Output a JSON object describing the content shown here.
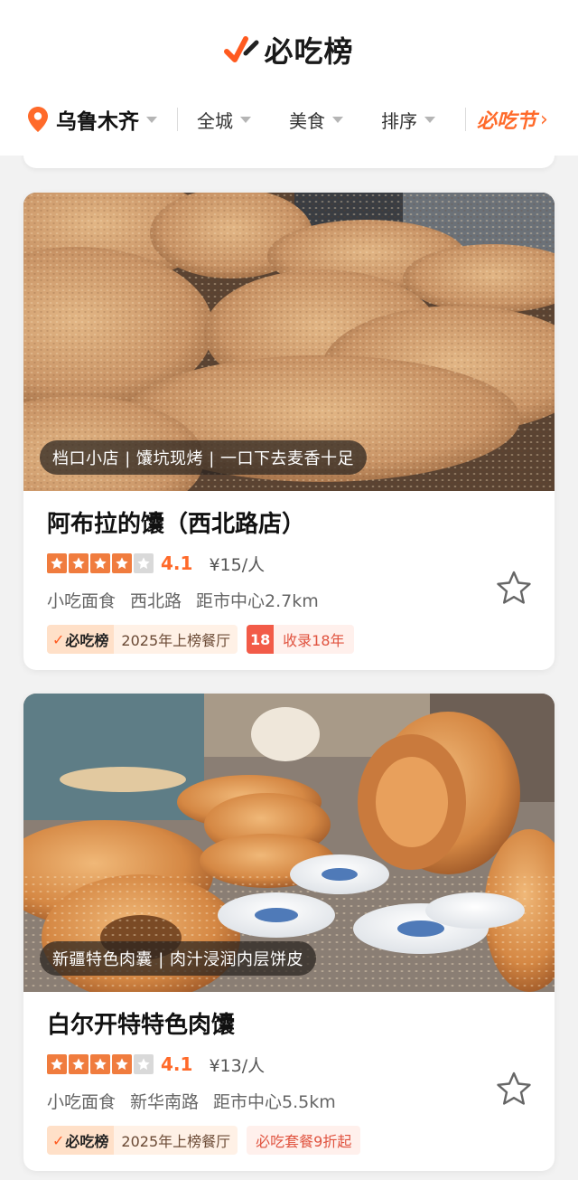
{
  "header": {
    "app_title": "必吃榜",
    "city": "乌鲁木齐",
    "filters": [
      "全城",
      "美食",
      "排序"
    ],
    "festival": "必吃节"
  },
  "colors": {
    "accent": "#ff6a2a",
    "star": "#f07c3e",
    "badge_red": "#f25b48"
  },
  "restaurants": [
    {
      "photo_tag": "档口小店 | 馕坑现烤 | 一口下去麦香十足",
      "name": "阿布拉的馕（西北路店）",
      "rating": 4.1,
      "rating_text": "4.1",
      "price": "¥15/人",
      "category": "小吃面食",
      "area": "西北路",
      "distance": "距市中心2.7km",
      "badge_logo": "必吃榜",
      "badge_text": "2025年上榜餐厅",
      "years_num": "18",
      "years_text": "收录18年",
      "fav_icon": "star-outline-icon"
    },
    {
      "photo_tag": "新疆特色肉囊 | 肉汁浸润内层饼皮",
      "name": "白尔开特特色肉馕",
      "rating": 4.1,
      "rating_text": "4.1",
      "price": "¥13/人",
      "category": "小吃面食",
      "area": "新华南路",
      "distance": "距市中心5.5km",
      "badge_logo": "必吃榜",
      "badge_text": "2025年上榜餐厅",
      "promo": "必吃套餐9折起",
      "fav_icon": "star-outline-icon"
    }
  ]
}
